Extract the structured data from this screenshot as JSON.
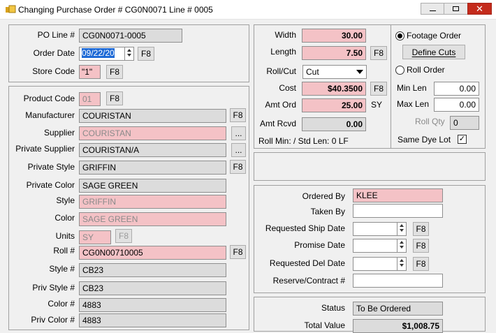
{
  "window": {
    "title": "Changing Purchase Order # CG0N0071  Line # 0005"
  },
  "colors": {
    "required": "#f4c2c6",
    "readonly": "#dcdcdc",
    "selection": "#1e6ad6"
  },
  "top_left": {
    "po_line_label": "PO Line #",
    "po_line_value": "CG0N0071-0005",
    "order_date_label": "Order Date",
    "order_date_value": "09/22/20",
    "store_code_label": "Store Code",
    "store_code_value": "\"1\"",
    "f8": "F8"
  },
  "product": {
    "product_code_label": "Product Code",
    "product_code_value": "01",
    "manufacturer_label": "Manufacturer",
    "manufacturer_value": "COURISTAN",
    "supplier_label": "Supplier",
    "supplier_value": "COURISTAN",
    "private_supplier_label": "Private Supplier",
    "private_supplier_value": "COURISTAN/A",
    "private_style_label": "Private Style",
    "private_style_value": "GRIFFIN",
    "private_color_label": "Private Color",
    "private_color_value": "SAGE GREEN",
    "style_label": "Style",
    "style_value": "GRIFFIN",
    "color_label": "Color",
    "color_value": "SAGE GREEN",
    "units_label": "Units",
    "units_value": "SY",
    "roll_label": "Roll #",
    "roll_value": "CG0N00710005",
    "style_num_label": "Style #",
    "style_num_value": "CB23",
    "priv_style_label": "Priv Style #",
    "priv_style_value": "CB23",
    "color_num_label": "Color #",
    "color_num_value": "4883",
    "priv_color_label": "Priv Color #",
    "priv_color_value": "4883",
    "ellipsis": "..."
  },
  "dims": {
    "width_label": "Width",
    "width_value": "30.00",
    "length_label": "Length",
    "length_value": "7.50",
    "rollcut_label": "Roll/Cut",
    "rollcut_value": "Cut",
    "cost_label": "Cost",
    "cost_value": "$40.3500",
    "amt_ord_label": "Amt Ord",
    "amt_ord_value": "25.00",
    "amt_ord_unit": "SY",
    "amt_rcvd_label": "Amt Rcvd",
    "amt_rcvd_value": "0.00",
    "roll_min_text": "Roll Min:  / Std Len: 0 LF"
  },
  "order_type": {
    "footage_order": "Footage Order",
    "define_cuts": "Define Cuts",
    "roll_order": "Roll Order",
    "min_len_label": "Min Len",
    "min_len_value": "0.00",
    "max_len_label": "Max Len",
    "max_len_value": "0.00",
    "roll_qty_label": "Roll Qty",
    "roll_qty_value": "0",
    "same_dye_lot_label": "Same Dye Lot",
    "same_dye_lot_checked": true,
    "check_glyph": "✓"
  },
  "ordering": {
    "ordered_by_label": "Ordered By",
    "ordered_by_value": "KLEE",
    "taken_by_label": "Taken By",
    "taken_by_value": "",
    "req_ship_label": "Requested Ship Date",
    "promise_label": "Promise Date",
    "req_del_label": "Requested Del Date",
    "reserve_label": "Reserve/Contract #",
    "f8": "F8"
  },
  "status": {
    "status_label": "Status",
    "status_value": "To Be Ordered",
    "total_label": "Total Value",
    "total_value": "$1,008.75"
  }
}
